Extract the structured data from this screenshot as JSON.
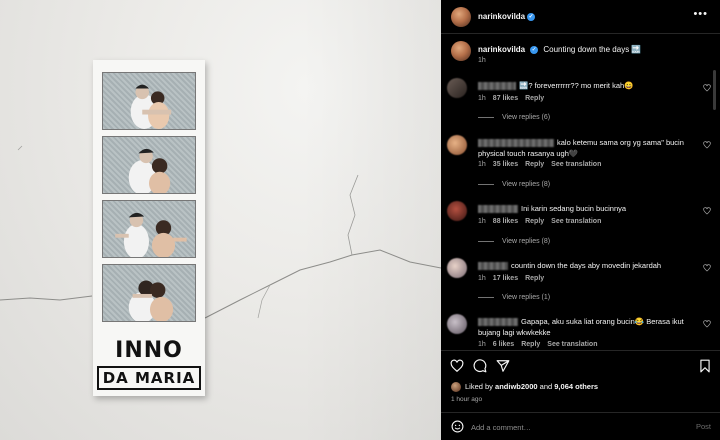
{
  "post": {
    "username": "narinkovilda",
    "verified": true,
    "more_icon": "more-options-icon",
    "caption_username": "narinkovilda",
    "caption_text": "Counting down the days 🔜",
    "caption_time": "1h"
  },
  "photo": {
    "description_icon": "photo-booth-strip",
    "brand_line1": "INNO",
    "brand_line2": "DA MARIA"
  },
  "comments": [
    {
      "text": "🔜? foreverrrrrr?? mo merit kah😀",
      "time": "1h",
      "likes": "87 likes",
      "reply": "Reply",
      "see_translation": "",
      "view_replies": "View replies (6)"
    },
    {
      "text": "kalo ketemu sama org yg sama\" bucin physical touch rasanya ugh🖤",
      "time": "1h",
      "likes": "35 likes",
      "reply": "Reply",
      "see_translation": "See translation",
      "view_replies": "View replies (8)"
    },
    {
      "text": "Ini karin sedang bucin bucinnya",
      "time": "1h",
      "likes": "88 likes",
      "reply": "Reply",
      "see_translation": "See translation",
      "view_replies": "View replies (8)"
    },
    {
      "text": "countin down the days aby movedin jekardah",
      "time": "1h",
      "likes": "17 likes",
      "reply": "Reply",
      "see_translation": "",
      "view_replies": "View replies (1)"
    },
    {
      "text": "Gapapa, aku suka liat orang bucin😂 Berasa ikut bujang lagi wkwkekke",
      "time": "1h",
      "likes": "6 likes",
      "reply": "Reply",
      "see_translation": "See translation",
      "view_replies": ""
    }
  ],
  "actions": {
    "like_icon": "heart-icon",
    "comment_icon": "comment-icon",
    "share_icon": "share-icon",
    "save_icon": "bookmark-icon"
  },
  "likes": {
    "prefix": "Liked by",
    "user": "andiwb2000",
    "middle": "and",
    "others": "9,064 others"
  },
  "posted_ago": "1 hour ago",
  "add_comment": {
    "placeholder": "Add a comment…",
    "post_label": "Post",
    "emoji_icon": "emoji-icon"
  },
  "colors": {
    "background": "#000000",
    "text": "#f5f5f5",
    "secondary": "#a8a8a8",
    "verified": "#3897f0",
    "post_disabled": "#6c6c6c"
  }
}
